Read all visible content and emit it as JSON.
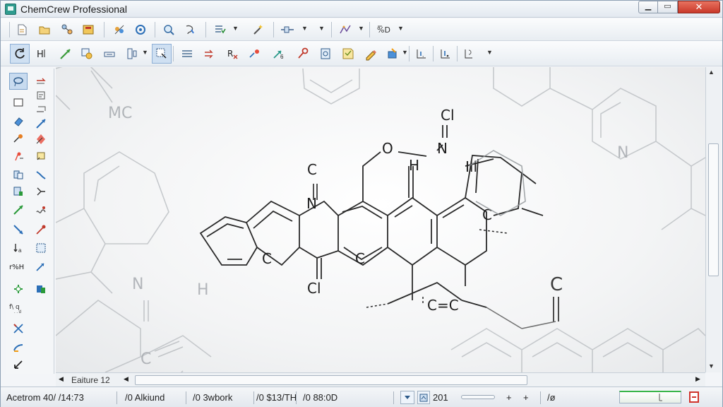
{
  "window": {
    "title": "ChemCrew Professional",
    "minimize": "▁",
    "maximize": "▭",
    "close": "✕"
  },
  "colors": {
    "accent": "#2f9c8f",
    "selection": "#c8dbef",
    "close_button": "#d0342c",
    "progress_green": "#39b54a"
  },
  "canvas": {
    "labels": {
      "mc": "MC",
      "cl_top": "Cl",
      "o_top": "O",
      "h_top": "H",
      "n_mid": "N",
      "n_right": "N",
      "h_right": "Ill",
      "c_left": "C",
      "c_below1": "C",
      "c_below2": "C",
      "c_below3": "C",
      "cl_bottom": "Cl",
      "n_left": "N",
      "h_left": "H",
      "c_ring": "C",
      "c_right_low": "C",
      "c_eq": "C=C",
      "n_far_right": "N"
    }
  },
  "hscroll": {
    "label": "Eaiture 12"
  },
  "statusbar": {
    "coords": "Acetrom  40/ /14:73",
    "item2": "/0 Alkiund",
    "item3": "/0 3wbork",
    "item4": "/0 $13/TH",
    "item5": "/0 88:0D",
    "page": "201",
    "plus1": "+",
    "plus2": "+",
    "mode": "/ø"
  },
  "icons": {
    "toolbar_row1": [
      "new-document-icon",
      "open-folder-icon",
      "molecule-template-icon",
      "save-icon",
      "atom-link-icon",
      "reaction-cycle-icon",
      "zoom-icon",
      "lasso-select-icon",
      "structure-check-icon",
      "magic-clean-icon",
      "bond-align-icon",
      "ring-template-icon",
      "name-to-structure-icon"
    ],
    "toolbar_row2": [
      "rotate-icon",
      "hydrogen-icon",
      "bond-draw-icon",
      "atom-search-icon",
      "chain-icon",
      "template-grid-icon",
      "selection-move-icon",
      "equal-bonds-icon",
      "arrow-icon",
      "charge-icon",
      "functional-group-icon",
      "reaction-arrow-icon",
      "key-icon",
      "document-icon",
      "note-icon",
      "pencil-icon",
      "orbital-icon",
      "label-icon",
      "spectrum-icon",
      "peak-icon"
    ],
    "palette": [
      "lasso-icon",
      "arrow-right-icon",
      "rectangle-select-icon",
      "eraser-icon",
      "diamond-icon",
      "arrow-up-icon",
      "text-tool-icon",
      "arrow-diagonal-icon",
      "atom-map-icon",
      "bracket-icon",
      "stereo-icon",
      "chain-tool-icon",
      "ring-icon",
      "wedge-bond-icon",
      "arrow-line-icon",
      "dash-bond-icon",
      "wavy-bond-icon",
      "h-bond-icon",
      "chiral-icon",
      "fragment-icon",
      "plus-charge-icon",
      "minus-charge-icon",
      "group-icon",
      "cross-icon",
      "orbital-tool-icon",
      "pen-tool-icon"
    ]
  }
}
